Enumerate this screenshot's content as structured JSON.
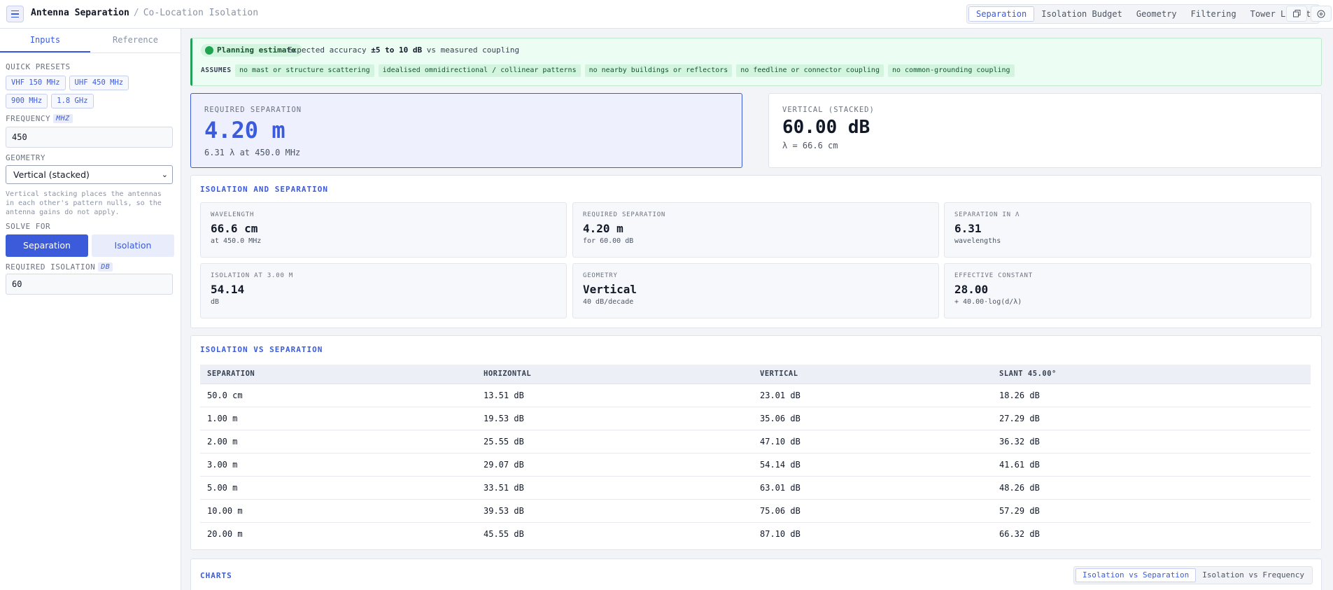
{
  "header": {
    "title": "Antenna Separation",
    "separator": "/",
    "subtitle": "Co-Location Isolation",
    "tabs": [
      "Separation",
      "Isolation Budget",
      "Geometry",
      "Filtering",
      "Tower Layout"
    ],
    "active_tab": "Separation",
    "icons": [
      "menu-icon",
      "copy-icon",
      "help-icon"
    ]
  },
  "sidebar": {
    "tabs": [
      "Inputs",
      "Reference"
    ],
    "quick_presets_label": "QUICK PRESETS",
    "presets": [
      "VHF 150 MHz",
      "UHF 450 MHz",
      "900 MHz",
      "1.8 GHz"
    ],
    "frequency_label": "FREQUENCY",
    "frequency_unit": "MHZ",
    "frequency_value": "450",
    "geometry_label": "GEOMETRY",
    "geometry_value": "Vertical (stacked)",
    "geometry_hint": "Vertical stacking places the antennas in each other's pattern nulls, so the antenna gains do not apply.",
    "solve_for_label": "SOLVE FOR",
    "solve_options": [
      "Separation",
      "Isolation"
    ],
    "required_isolation_label": "REQUIRED ISOLATION",
    "required_isolation_unit": "DB",
    "required_isolation_value": "60"
  },
  "banner": {
    "badge": "Planning estimate",
    "text_prefix": "Expected accuracy",
    "text_bold": "±5 to 10 dB",
    "text_suffix": "vs measured coupling",
    "assumes_label": "ASSUMES",
    "assumptions": [
      "no mast or structure scattering",
      "idealised omnidirectional / collinear patterns",
      "no nearby buildings or reflectors",
      "no feedline or connector coupling",
      "no common-grounding coupling"
    ]
  },
  "result_primary": {
    "label": "REQUIRED SEPARATION",
    "value": "4.20 m",
    "sub": "6.31 λ at 450.0 MHz"
  },
  "result_secondary": {
    "label": "VERTICAL (STACKED)",
    "value": "60.00 dB",
    "sub": "λ = 66.6 cm"
  },
  "iso_section": {
    "title": "ISOLATION AND SEPARATION",
    "metrics": [
      {
        "label": "WAVELENGTH",
        "value": "66.6 cm",
        "sub": "at 450.0 MHz"
      },
      {
        "label": "REQUIRED SEPARATION",
        "value": "4.20 m",
        "sub": "for 60.00 dB"
      },
      {
        "label": "SEPARATION IN λ",
        "value": "6.31",
        "sub": "wavelengths"
      },
      {
        "label": "ISOLATION AT 3.00 M",
        "value": "54.14",
        "sub": "dB"
      },
      {
        "label": "GEOMETRY",
        "value": "Vertical",
        "sub": "40 dB/decade"
      },
      {
        "label": "EFFECTIVE CONSTANT",
        "value": "28.00",
        "sub": "+ 40.00·log(d/λ)"
      }
    ]
  },
  "table_section": {
    "title": "ISOLATION VS SEPARATION",
    "columns": [
      "SEPARATION",
      "HORIZONTAL",
      "VERTICAL",
      "SLANT 45.00°"
    ],
    "rows": [
      [
        "50.0 cm",
        "13.51 dB",
        "23.01 dB",
        "18.26 dB"
      ],
      [
        "1.00 m",
        "19.53 dB",
        "35.06 dB",
        "27.29 dB"
      ],
      [
        "2.00 m",
        "25.55 dB",
        "47.10 dB",
        "36.32 dB"
      ],
      [
        "3.00 m",
        "29.07 dB",
        "54.14 dB",
        "41.61 dB"
      ],
      [
        "5.00 m",
        "33.51 dB",
        "63.01 dB",
        "48.26 dB"
      ],
      [
        "10.00 m",
        "39.53 dB",
        "75.06 dB",
        "57.29 dB"
      ],
      [
        "20.00 m",
        "45.55 dB",
        "87.10 dB",
        "66.32 dB"
      ]
    ]
  },
  "charts_section": {
    "title": "CHARTS",
    "tabs": [
      "Isolation vs Separation",
      "Isolation vs Frequency"
    ],
    "active_tab": "Isolation vs Separation"
  },
  "colors": {
    "accent": "#3b5bdb",
    "success": "#1ea34f",
    "banner_bg": "#ecfdf3"
  }
}
